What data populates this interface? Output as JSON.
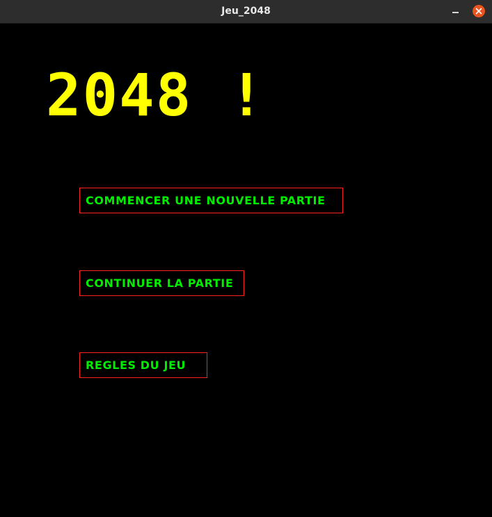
{
  "window": {
    "title": "Jeu_2048"
  },
  "game": {
    "title": "2048 !"
  },
  "menu": {
    "new_game": "Commencer une nouvelle partie",
    "continue_game": "Continuer la partie",
    "rules": "Regles du jeu"
  },
  "colors": {
    "background": "#000000",
    "title": "#ffff00",
    "button_text": "#00ee00",
    "button_border": "#ff2020",
    "titlebar": "#2d2d2d",
    "close_button": "#e95420"
  },
  "icons": {
    "minimize": "minimize-icon",
    "close": "close-icon"
  }
}
